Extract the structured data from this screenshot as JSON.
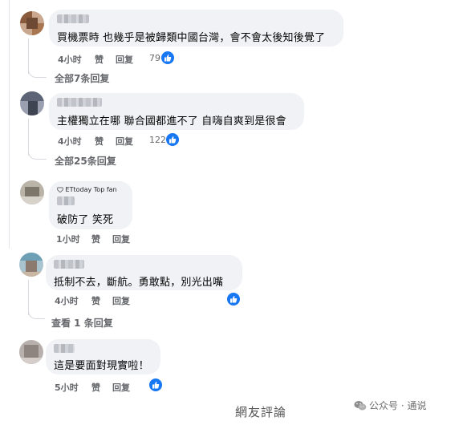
{
  "comments": [
    {
      "text": "買機票時 也幾乎是被歸類中國台灣，會不會太後知後覺了",
      "time": "4小时",
      "like_label": "赞",
      "reply_label": "回复",
      "reaction_count": "79",
      "replies_link": "全部7条回复"
    },
    {
      "text": "主權獨立在哪 聯合國都進不了 自嗨自爽到是很會",
      "time": "4小时",
      "like_label": "赞",
      "reply_label": "回复",
      "reaction_count": "122",
      "replies_link": "全部25条回复"
    },
    {
      "badge": "ETtoday Top fan",
      "text": "破防了 笑死",
      "time": "1小时",
      "like_label": "赞",
      "reply_label": "回复"
    },
    {
      "text": "抵制不去，斷航。勇敢點，別光出嘴",
      "time": "4小时",
      "like_label": "赞",
      "reply_label": "回复",
      "replies_link": "查看 1 条回复"
    },
    {
      "text": "這是要面對現實啦！",
      "time": "5小时",
      "like_label": "赞",
      "reply_label": "回复"
    }
  ],
  "footer": {
    "caption": "網友評論",
    "watermark": "公众号 · 通说"
  },
  "colors": {
    "bubble": "#f0f2f5",
    "like_badge": "#1877f2",
    "meta_text": "#65676b"
  },
  "icons": [
    "thumbs-up-icon",
    "gem-badge-icon",
    "wechat-icon"
  ]
}
